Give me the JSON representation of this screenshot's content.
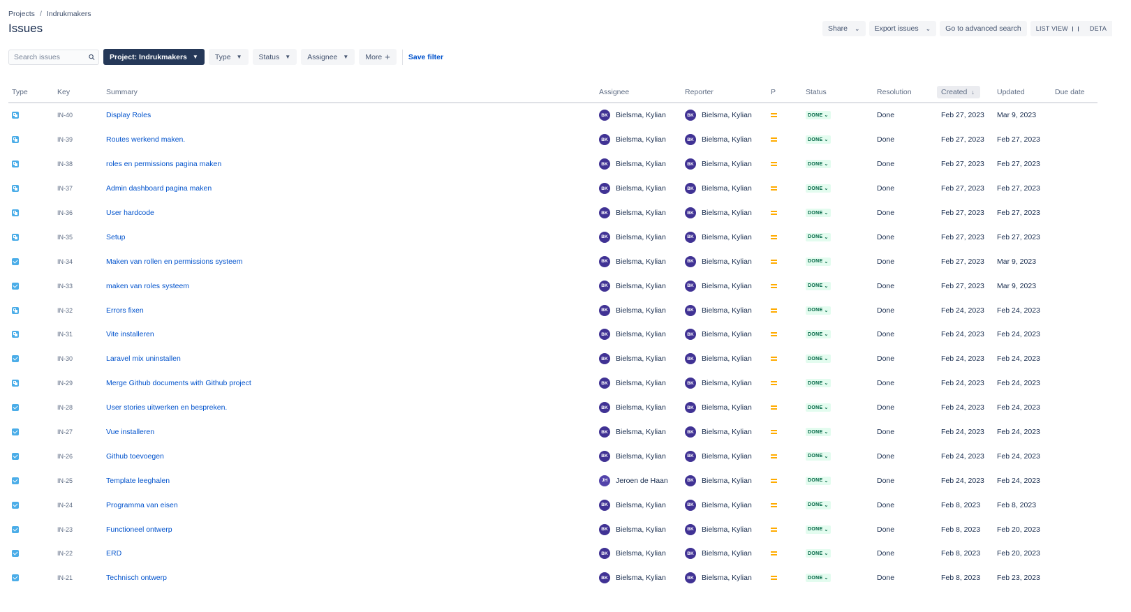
{
  "breadcrumb": {
    "projects": "Projects",
    "separator": "/",
    "project": "Indrukmakers"
  },
  "page_title": "Issues",
  "actions": {
    "share": "Share",
    "export": "Export issues",
    "advanced": "Go to advanced search",
    "list_view": "LIST VIEW",
    "detail_view": "DETA"
  },
  "search": {
    "placeholder": "Search issues"
  },
  "filters": {
    "project": "Project: Indrukmakers",
    "type": "Type",
    "status": "Status",
    "assignee": "Assignee",
    "more": "More",
    "save": "Save filter"
  },
  "columns": {
    "type": "Type",
    "key": "Key",
    "summary": "Summary",
    "assignee": "Assignee",
    "reporter": "Reporter",
    "priority": "P",
    "status": "Status",
    "resolution": "Resolution",
    "created": "Created",
    "updated": "Updated",
    "due": "Due date"
  },
  "colors": {
    "link": "#0052cc",
    "done_text": "#006644",
    "done_bg": "#e3fcef",
    "priority_medium": "#ffab00",
    "avatar": "#403294",
    "active_filter": "#253858"
  },
  "issues": [
    {
      "type": "subtask",
      "key": "IN-40",
      "summary": "Display Roles",
      "assignee": "Bielsma, Kylian",
      "assignee_initials": "BK",
      "reporter": "Bielsma, Kylian",
      "reporter_initials": "BK",
      "status": "DONE",
      "resolution": "Done",
      "created": "Feb 27, 2023",
      "updated": "Mar 9, 2023"
    },
    {
      "type": "subtask",
      "key": "IN-39",
      "summary": "Routes werkend maken.",
      "assignee": "Bielsma, Kylian",
      "assignee_initials": "BK",
      "reporter": "Bielsma, Kylian",
      "reporter_initials": "BK",
      "status": "DONE",
      "resolution": "Done",
      "created": "Feb 27, 2023",
      "updated": "Feb 27, 2023"
    },
    {
      "type": "subtask",
      "key": "IN-38",
      "summary": "roles en permissions pagina maken",
      "assignee": "Bielsma, Kylian",
      "assignee_initials": "BK",
      "reporter": "Bielsma, Kylian",
      "reporter_initials": "BK",
      "status": "DONE",
      "resolution": "Done",
      "created": "Feb 27, 2023",
      "updated": "Feb 27, 2023"
    },
    {
      "type": "subtask",
      "key": "IN-37",
      "summary": "Admin dashboard pagina maken",
      "assignee": "Bielsma, Kylian",
      "assignee_initials": "BK",
      "reporter": "Bielsma, Kylian",
      "reporter_initials": "BK",
      "status": "DONE",
      "resolution": "Done",
      "created": "Feb 27, 2023",
      "updated": "Feb 27, 2023"
    },
    {
      "type": "subtask",
      "key": "IN-36",
      "summary": "User hardcode",
      "assignee": "Bielsma, Kylian",
      "assignee_initials": "BK",
      "reporter": "Bielsma, Kylian",
      "reporter_initials": "BK",
      "status": "DONE",
      "resolution": "Done",
      "created": "Feb 27, 2023",
      "updated": "Feb 27, 2023"
    },
    {
      "type": "subtask",
      "key": "IN-35",
      "summary": "Setup",
      "assignee": "Bielsma, Kylian",
      "assignee_initials": "BK",
      "reporter": "Bielsma, Kylian",
      "reporter_initials": "BK",
      "status": "DONE",
      "resolution": "Done",
      "created": "Feb 27, 2023",
      "updated": "Feb 27, 2023"
    },
    {
      "type": "task",
      "key": "IN-34",
      "summary": "Maken van rollen en permissions systeem",
      "assignee": "Bielsma, Kylian",
      "assignee_initials": "BK",
      "reporter": "Bielsma, Kylian",
      "reporter_initials": "BK",
      "status": "DONE",
      "resolution": "Done",
      "created": "Feb 27, 2023",
      "updated": "Mar 9, 2023"
    },
    {
      "type": "task",
      "key": "IN-33",
      "summary": "maken van roles systeem",
      "assignee": "Bielsma, Kylian",
      "assignee_initials": "BK",
      "reporter": "Bielsma, Kylian",
      "reporter_initials": "BK",
      "status": "DONE",
      "resolution": "Done",
      "created": "Feb 27, 2023",
      "updated": "Mar 9, 2023"
    },
    {
      "type": "subtask",
      "key": "IN-32",
      "summary": "Errors fixen",
      "assignee": "Bielsma, Kylian",
      "assignee_initials": "BK",
      "reporter": "Bielsma, Kylian",
      "reporter_initials": "BK",
      "status": "DONE",
      "resolution": "Done",
      "created": "Feb 24, 2023",
      "updated": "Feb 24, 2023"
    },
    {
      "type": "subtask",
      "key": "IN-31",
      "summary": "Vite installeren",
      "assignee": "Bielsma, Kylian",
      "assignee_initials": "BK",
      "reporter": "Bielsma, Kylian",
      "reporter_initials": "BK",
      "status": "DONE",
      "resolution": "Done",
      "created": "Feb 24, 2023",
      "updated": "Feb 24, 2023"
    },
    {
      "type": "task",
      "key": "IN-30",
      "summary": "Laravel mix uninstallen",
      "assignee": "Bielsma, Kylian",
      "assignee_initials": "BK",
      "reporter": "Bielsma, Kylian",
      "reporter_initials": "BK",
      "status": "DONE",
      "resolution": "Done",
      "created": "Feb 24, 2023",
      "updated": "Feb 24, 2023"
    },
    {
      "type": "subtask",
      "key": "IN-29",
      "summary": "Merge Github documents with Github project",
      "assignee": "Bielsma, Kylian",
      "assignee_initials": "BK",
      "reporter": "Bielsma, Kylian",
      "reporter_initials": "BK",
      "status": "DONE",
      "resolution": "Done",
      "created": "Feb 24, 2023",
      "updated": "Feb 24, 2023"
    },
    {
      "type": "task",
      "key": "IN-28",
      "summary": "User stories uitwerken en bespreken.",
      "assignee": "Bielsma, Kylian",
      "assignee_initials": "BK",
      "reporter": "Bielsma, Kylian",
      "reporter_initials": "BK",
      "status": "DONE",
      "resolution": "Done",
      "created": "Feb 24, 2023",
      "updated": "Feb 24, 2023"
    },
    {
      "type": "task",
      "key": "IN-27",
      "summary": "Vue installeren",
      "assignee": "Bielsma, Kylian",
      "assignee_initials": "BK",
      "reporter": "Bielsma, Kylian",
      "reporter_initials": "BK",
      "status": "DONE",
      "resolution": "Done",
      "created": "Feb 24, 2023",
      "updated": "Feb 24, 2023"
    },
    {
      "type": "task",
      "key": "IN-26",
      "summary": "Github toevoegen",
      "assignee": "Bielsma, Kylian",
      "assignee_initials": "BK",
      "reporter": "Bielsma, Kylian",
      "reporter_initials": "BK",
      "status": "DONE",
      "resolution": "Done",
      "created": "Feb 24, 2023",
      "updated": "Feb 24, 2023"
    },
    {
      "type": "task",
      "key": "IN-25",
      "summary": "Template leeghalen",
      "assignee": "Jeroen de Haan",
      "assignee_initials": "JH",
      "reporter": "Bielsma, Kylian",
      "reporter_initials": "BK",
      "status": "DONE",
      "resolution": "Done",
      "created": "Feb 24, 2023",
      "updated": "Feb 24, 2023"
    },
    {
      "type": "task",
      "key": "IN-24",
      "summary": "Programma van eisen",
      "assignee": "Bielsma, Kylian",
      "assignee_initials": "BK",
      "reporter": "Bielsma, Kylian",
      "reporter_initials": "BK",
      "status": "DONE",
      "resolution": "Done",
      "created": "Feb 8, 2023",
      "updated": "Feb 8, 2023"
    },
    {
      "type": "task",
      "key": "IN-23",
      "summary": "Functioneel ontwerp",
      "assignee": "Bielsma, Kylian",
      "assignee_initials": "BK",
      "reporter": "Bielsma, Kylian",
      "reporter_initials": "BK",
      "status": "DONE",
      "resolution": "Done",
      "created": "Feb 8, 2023",
      "updated": "Feb 20, 2023"
    },
    {
      "type": "task",
      "key": "IN-22",
      "summary": "ERD",
      "assignee": "Bielsma, Kylian",
      "assignee_initials": "BK",
      "reporter": "Bielsma, Kylian",
      "reporter_initials": "BK",
      "status": "DONE",
      "resolution": "Done",
      "created": "Feb 8, 2023",
      "updated": "Feb 20, 2023"
    },
    {
      "type": "task",
      "key": "IN-21",
      "summary": "Technisch ontwerp",
      "assignee": "Bielsma, Kylian",
      "assignee_initials": "BK",
      "reporter": "Bielsma, Kylian",
      "reporter_initials": "BK",
      "status": "DONE",
      "resolution": "Done",
      "created": "Feb 8, 2023",
      "updated": "Feb 23, 2023"
    }
  ]
}
